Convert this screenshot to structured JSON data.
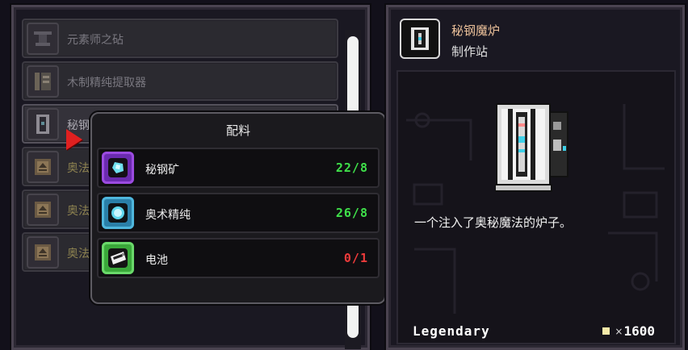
{
  "crafting_list": {
    "items": [
      {
        "label": "元素师之砧",
        "icon": "anvil-icon"
      },
      {
        "label": "木制精纯提取器",
        "icon": "extractor-icon"
      },
      {
        "label": "秘钢",
        "icon": "furnace-icon"
      },
      {
        "label": "奥法",
        "icon": "arcane-book-icon"
      },
      {
        "label": "奥法",
        "icon": "arcane-book-icon"
      },
      {
        "label": "奥法",
        "icon": "arcane-book-icon"
      }
    ]
  },
  "ingredients": {
    "title": "配料",
    "rows": [
      {
        "name": "秘钢矿",
        "count": "22/8",
        "icon": "ore-icon",
        "status_color": "#3fe04a"
      },
      {
        "name": "奥术精纯",
        "count": "26/8",
        "icon": "essence-orb-icon",
        "status_color": "#3fe04a"
      },
      {
        "name": "电池",
        "count": "0/1",
        "icon": "battery-icon",
        "status_color": "#ee3b3b"
      }
    ]
  },
  "detail": {
    "title": "秘钢魔炉",
    "subtitle": "制作站",
    "description": "一个注入了奥秘魔法的炉子。",
    "rarity": "Legendary",
    "price_prefix": "×",
    "price": "1600",
    "title_color": "#ecc19a"
  }
}
